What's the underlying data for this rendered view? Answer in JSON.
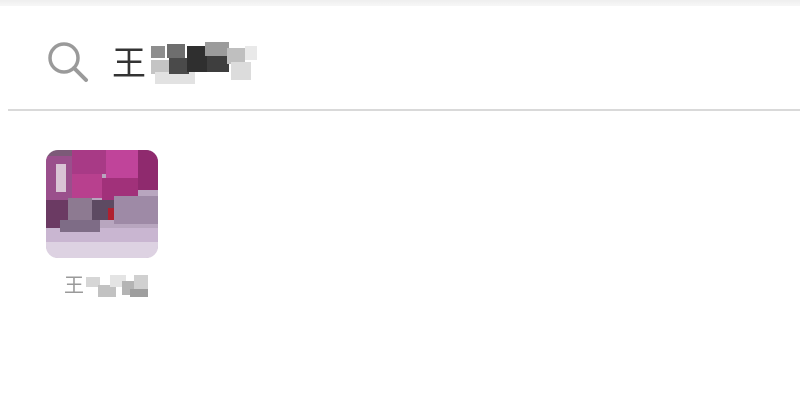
{
  "search": {
    "icon": "search-icon",
    "query_visible_text": "王",
    "query_obscured": true
  },
  "results": [
    {
      "name_visible_text": "王",
      "name_obscured": true,
      "avatar_obscured": true,
      "avatar_colors": [
        "#a83a86",
        "#6b3a63",
        "#c9b6d1",
        "#8f2a6e"
      ]
    }
  ]
}
